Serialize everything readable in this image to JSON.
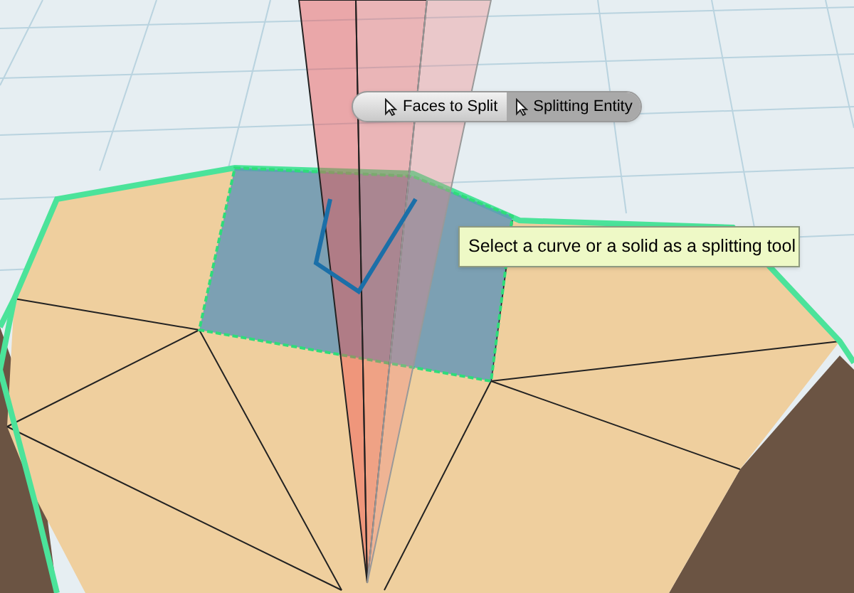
{
  "toolbar": {
    "buttons": [
      {
        "label": "Faces to Split",
        "selected": false
      },
      {
        "label": "Splitting Entity",
        "selected": true
      }
    ]
  },
  "tooltip": {
    "text": "Select a curve or a solid as a splitting tool"
  }
}
